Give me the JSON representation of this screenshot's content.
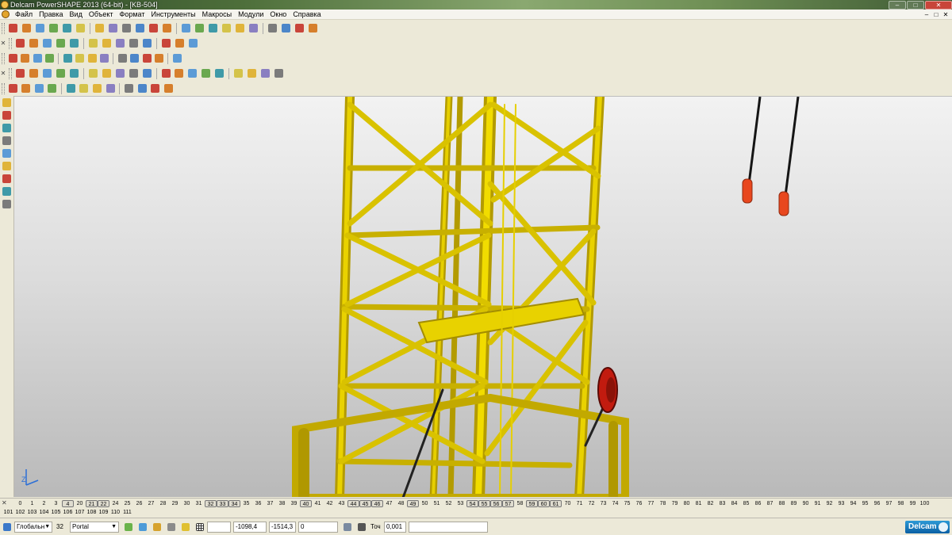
{
  "window": {
    "title": "Delcam PowerSHAPE 2013 (64-bit) - [KB-504]",
    "buttons": {
      "minimize": "–",
      "maximize": "□",
      "close": "✕"
    }
  },
  "menu": {
    "items": [
      "Файл",
      "Правка",
      "Вид",
      "Объект",
      "Формат",
      "Инструменты",
      "Макросы",
      "Модули",
      "Окно",
      "Справка"
    ],
    "mdi": [
      "–",
      "□",
      "✕"
    ]
  },
  "toolbars": {
    "row1_icons": [
      "new-icon",
      "open-icon",
      "save-icon",
      "save-as-icon",
      "print-icon",
      "cut-icon",
      "copy-icon",
      "paste-icon",
      "brush-icon",
      "delete-icon",
      "undo-icon",
      "redo-icon",
      "text-icon",
      "find-icon",
      "line-icon",
      "arc-icon",
      "circle-icon",
      "curve-icon",
      "pan-icon",
      "shade-icon",
      "cube-icon",
      "wand-icon"
    ],
    "row2_icons": [
      "box-icon",
      "box2-icon",
      "plane-icon",
      "sphere-view-icon",
      "move-icon",
      "zoom-icon",
      "zoom-box-icon",
      "zoom-fit-icon",
      "globe-icon",
      "render-icon",
      "material-icon",
      "light-icon",
      "hand-icon"
    ],
    "row3_icons": [
      "layer-icon",
      "text-doc-icon",
      "table-icon",
      "wire-icon",
      "sphere-red-icon",
      "sphere-green-icon",
      "triangle-icon",
      "triangle2-icon",
      "box-yellow-icon",
      "frame-icon",
      "info-icon",
      "dim-icon",
      "arrow-green-icon"
    ],
    "row4_icons": [
      "surface-icon",
      "solid-icon",
      "swept-icon",
      "revolve-icon",
      "fillet-icon",
      "smooth-icon",
      "mesh-icon",
      "wireframe-icon",
      "select-blue-icon",
      "select2-icon",
      "select3-icon",
      "multi-icon",
      "red-cross-icon",
      "stack-icon",
      "stack2-icon",
      "stack3-icon",
      "assembly-icon",
      "assembly2-icon",
      "align-icon"
    ],
    "row5_icons": [
      "sphere-gray-icon",
      "axis-icon",
      "workplane-icon",
      "teapot-icon",
      "gears-icon",
      "cam-icon",
      "tools-icon",
      "group-icon",
      "flip-icon",
      "solid2-icon",
      "fill-icon",
      "pyramid-icon"
    ]
  },
  "left_tools": [
    "select-arrow-icon",
    "layers-icon",
    "surfaces-icon",
    "solids-icon",
    "wire-tool-icon",
    "fillet-tool-icon",
    "patch-icon",
    "analysis-icon",
    "sheet-icon"
  ],
  "viewport": {
    "background": "#d8d8d8",
    "structure_color": "#f0d400",
    "hook_color": "#e8471e",
    "axis_label": "Z"
  },
  "levels": {
    "row1": [
      {
        "n": "0",
        "on": false
      },
      {
        "n": "1",
        "on": false
      },
      {
        "n": "2",
        "on": false
      },
      {
        "n": "3",
        "on": false
      },
      {
        "n": "4",
        "on": true
      },
      {
        "n": "20",
        "on": false
      },
      {
        "n": "21",
        "on": true
      },
      {
        "n": "22",
        "on": true
      },
      {
        "n": "24",
        "on": false
      },
      {
        "n": "25",
        "on": false
      },
      {
        "n": "26",
        "on": false
      },
      {
        "n": "27",
        "on": false
      },
      {
        "n": "28",
        "on": false
      },
      {
        "n": "29",
        "on": false
      },
      {
        "n": "30",
        "on": false
      },
      {
        "n": "31",
        "on": false
      },
      {
        "n": "32",
        "on": true
      },
      {
        "n": "33",
        "on": true
      },
      {
        "n": "34",
        "on": true
      },
      {
        "n": "35",
        "on": false
      },
      {
        "n": "36",
        "on": false
      },
      {
        "n": "37",
        "on": false
      },
      {
        "n": "38",
        "on": false
      },
      {
        "n": "39",
        "on": false
      },
      {
        "n": "40",
        "on": true
      },
      {
        "n": "41",
        "on": false
      },
      {
        "n": "42",
        "on": false
      },
      {
        "n": "43",
        "on": false
      },
      {
        "n": "44",
        "on": true
      },
      {
        "n": "45",
        "on": true
      },
      {
        "n": "46",
        "on": true
      },
      {
        "n": "47",
        "on": false
      },
      {
        "n": "48",
        "on": false
      },
      {
        "n": "49",
        "on": true
      },
      {
        "n": "50",
        "on": false
      },
      {
        "n": "51",
        "on": false
      },
      {
        "n": "52",
        "on": false
      },
      {
        "n": "53",
        "on": false
      },
      {
        "n": "54",
        "on": true
      },
      {
        "n": "55",
        "on": true
      },
      {
        "n": "56",
        "on": true
      },
      {
        "n": "57",
        "on": true
      },
      {
        "n": "58",
        "on": false
      },
      {
        "n": "59",
        "on": true
      },
      {
        "n": "60",
        "on": true
      },
      {
        "n": "61",
        "on": true
      },
      {
        "n": "70",
        "on": false
      },
      {
        "n": "71",
        "on": false
      },
      {
        "n": "72",
        "on": false
      },
      {
        "n": "73",
        "on": false
      },
      {
        "n": "74",
        "on": false
      },
      {
        "n": "75",
        "on": false
      },
      {
        "n": "76",
        "on": false
      },
      {
        "n": "77",
        "on": false
      },
      {
        "n": "78",
        "on": false
      },
      {
        "n": "79",
        "on": false
      },
      {
        "n": "80",
        "on": false
      },
      {
        "n": "81",
        "on": false
      },
      {
        "n": "82",
        "on": false
      },
      {
        "n": "83",
        "on": false
      },
      {
        "n": "84",
        "on": false
      },
      {
        "n": "85",
        "on": false
      },
      {
        "n": "86",
        "on": false
      },
      {
        "n": "87",
        "on": false
      },
      {
        "n": "88",
        "on": false
      },
      {
        "n": "89",
        "on": false
      },
      {
        "n": "90",
        "on": false
      },
      {
        "n": "91",
        "on": false
      },
      {
        "n": "92",
        "on": false
      },
      {
        "n": "93",
        "on": false
      },
      {
        "n": "94",
        "on": false
      },
      {
        "n": "95",
        "on": false
      },
      {
        "n": "96",
        "on": false
      },
      {
        "n": "97",
        "on": false
      },
      {
        "n": "98",
        "on": false
      },
      {
        "n": "99",
        "on": false
      },
      {
        "n": "100",
        "on": false
      }
    ],
    "row2": [
      "101",
      "102",
      "103",
      "104",
      "105",
      "106",
      "107",
      "108",
      "109",
      "110",
      "111"
    ]
  },
  "status": {
    "workplane": "Глобальн",
    "level_number": "32",
    "level_name": "Portal",
    "x": "-1098,4",
    "y": "-1514,3",
    "z": "0",
    "tolerance_label": "Точ",
    "tolerance": "0,001",
    "brand": "Delcam"
  }
}
